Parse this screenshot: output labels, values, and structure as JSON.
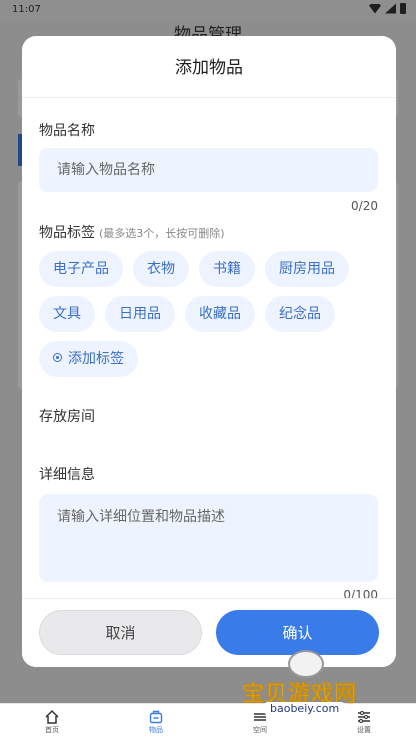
{
  "status_bar": {
    "time": "11:07"
  },
  "background": {
    "title": "物品管理"
  },
  "dialog": {
    "title": "添加物品",
    "name_field": {
      "label": "物品名称",
      "placeholder": "请输入物品名称",
      "counter": "0/20"
    },
    "tags_field": {
      "label": "物品标签",
      "hint": "(最多选3个，长按可删除)",
      "tags": [
        "电子产品",
        "衣物",
        "书籍",
        "厨房用品",
        "文具",
        "日用品",
        "收藏品",
        "纪念品"
      ],
      "add_label": "添加标签"
    },
    "room_field": {
      "label": "存放房间"
    },
    "detail_field": {
      "label": "详细信息",
      "placeholder": "请输入详细位置和物品描述",
      "counter": "0/100"
    },
    "buttons": {
      "cancel": "取消",
      "confirm": "确认"
    }
  },
  "nav": [
    {
      "label": "首页",
      "icon": "home-icon"
    },
    {
      "label": "物品",
      "icon": "box-icon"
    },
    {
      "label": "空间",
      "icon": "layers-icon"
    },
    {
      "label": "设置",
      "icon": "settings-icon"
    }
  ],
  "watermark": {
    "text": "宝贝游戏网",
    "url": "baobeiy.com"
  },
  "colors": {
    "accent": "#3a7bea",
    "chip_bg": "#edf4ff",
    "chip_text": "#3b6fc4"
  }
}
